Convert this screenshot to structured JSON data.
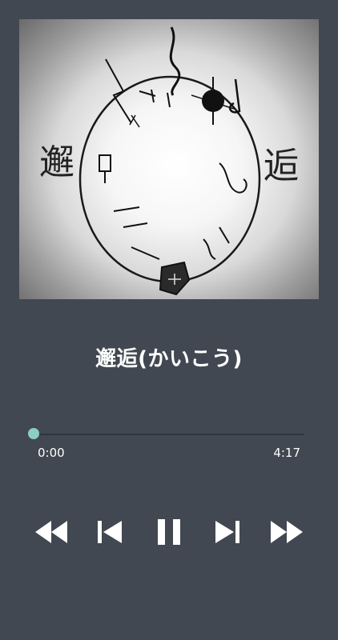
{
  "album_art": {
    "left_char": "邂",
    "right_char": "逅"
  },
  "track": {
    "title": "邂逅(かいこう)"
  },
  "playback": {
    "elapsed": "0:00",
    "total": "4:17",
    "progress_fraction": 0.0
  },
  "controls": {
    "rewind": "fast-rewind-icon",
    "previous": "skip-previous-icon",
    "pause": "pause-icon",
    "next": "skip-next-icon",
    "forward": "fast-forward-icon"
  },
  "colors": {
    "background": "#414851",
    "accent": "#8ecdc6",
    "text": "#ffffff"
  }
}
